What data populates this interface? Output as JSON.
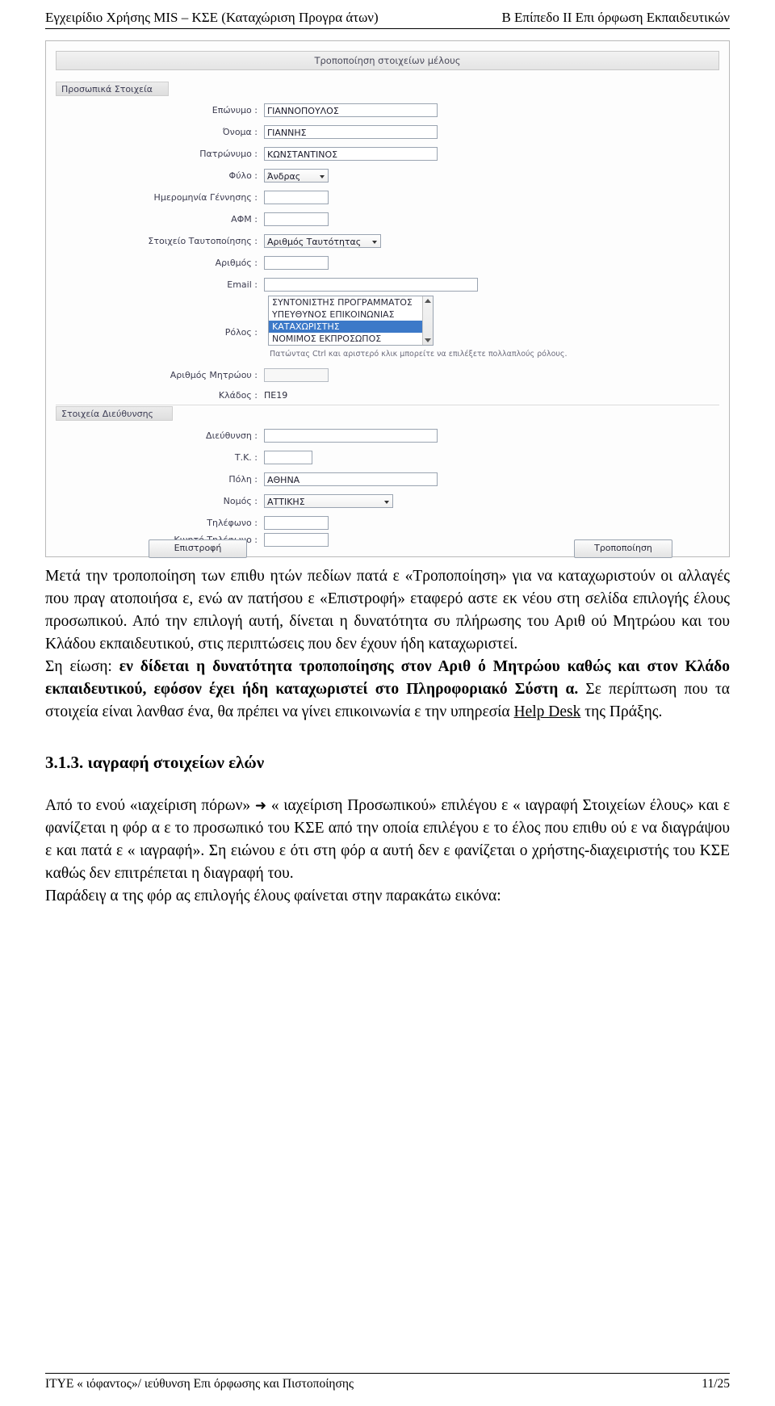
{
  "header": {
    "left": "Εγχειρίδιο Χρήσης MIS – ΚΣΕ (Καταχώριση Προγρα    άτων)",
    "right": "Β  Επίπεδο ΙΙ Επι  όρφωση Εκπαιδευτικών"
  },
  "figure": {
    "title": "Τροποποίηση στοιχείων μέλους",
    "section_personal": "Προσωπικά Στοιχεία",
    "section_address": "Στοιχεία Διεύθυνσης",
    "fields": [
      {
        "label": "Επώνυμο :",
        "value": "ΓΙΑΝΝΟΠΟΥΛΟΣ",
        "type": "text"
      },
      {
        "label": "Όνομα :",
        "value": "ΓΙΑΝΝΗΣ",
        "type": "text"
      },
      {
        "label": "Πατρώνυμο :",
        "value": "ΚΩΝΣΤΑΝΤΙΝΟΣ",
        "type": "text"
      },
      {
        "label": "Φύλο :",
        "value": "Άνδρας",
        "type": "select"
      },
      {
        "label": "Ημερομηνία Γέννησης :",
        "value": "",
        "type": "text"
      },
      {
        "label": "ΑΦΜ :",
        "value": "",
        "type": "text"
      },
      {
        "label": "Στοιχείο Ταυτοποίησης :",
        "value": "Αριθμός Ταυτότητας",
        "type": "select"
      },
      {
        "label": "Αριθμός :",
        "value": "",
        "type": "text"
      },
      {
        "label": "Email :",
        "value": "",
        "type": "text"
      },
      {
        "label": "Ρόλος :",
        "value": "",
        "type": "listbox"
      },
      {
        "label": "Αριθμός Μητρώου :",
        "value": "",
        "type": "text"
      },
      {
        "label": "Κλάδος :",
        "value": "ΠΕ19",
        "type": "text-plain"
      },
      {
        "label": "Διεύθυνση :",
        "value": "",
        "type": "text"
      },
      {
        "label": "Τ.Κ. :",
        "value": "",
        "type": "text"
      },
      {
        "label": "Πόλη :",
        "value": "ΑΘΗΝΑ",
        "type": "text"
      },
      {
        "label": "Νομός :",
        "value": "ΑΤΤΙΚΗΣ",
        "type": "select"
      },
      {
        "label": "Τηλέφωνο :",
        "value": "",
        "type": "text"
      },
      {
        "label": "Κινητό Τηλέφωνο :",
        "value": "",
        "type": "text"
      }
    ],
    "roles": [
      "ΣΥΝΤΟΝΙΣΤΗΣ ΠΡΟΓΡΑΜΜΑΤΟΣ",
      "ΥΠΕΥΘΥΝΟΣ ΕΠΙΚΟΙΝΩΝΙΑΣ",
      "ΚΑΤΑΧΩΡΙΣΤΗΣ",
      "ΝΟΜΙΜΟΣ ΕΚΠΡΟΣΩΠΟΣ"
    ],
    "roles_selected_index": 2,
    "roles_hint": "Πατώντας Ctrl και αριστερό κλικ μπορείτε να επιλέξετε πολλαπλούς ρόλους.",
    "buttons": {
      "back": "Επιστροφή",
      "modify": "Τροποποίηση"
    }
  },
  "text": {
    "p1_part1": "Μετά την τροποποίηση των επιθυ  ητών πεδίων πατά  ε «Τροποποίηση» για να καταχωριστούν οι αλλαγές που πραγ  ατοποιήσα  ε, ενώ αν πατήσου  ε «Επιστροφή» ",
    "p1_part2": "εταφερό  αστε εκ νέου στη σελίδα επιλογής   έλους προσωπικού. Από την επιλογή αυτή, δίνεται η δυνατότητα συ  πλήρωσης του Αριθ  ού Μητρώου και του Κλάδου εκπαιδευτικού, στις περιπτώσεις που δεν έχουν ήδη καταχωριστεί.",
    "p2_lead": "Ση  είωση:",
    "p2_bold": "εν δίδεται η δυνατότητα τροποποίησης στον Αριθ ό Μητρώου καθώς και στον Κλάδο εκπαιδευτικού, εφόσον έχει ήδη καταχωριστεί στο Πληροφοριακό Σύστη α.",
    "p2_rest_a": " Σε περίπτωση που τα στοιχεία είναι λανθασ  ένα, θα πρέπει να γίνει επικοινωνία   ε την υπηρεσία ",
    "p2_link": "Help Desk",
    "p2_rest_b": " της Πράξης.",
    "heading": "3.1.3.    ιαγραφή στοιχείων   ελών",
    "p3_a": "Από το   ενού «",
    "p3_menu1": "ιαχείριση  πόρων»",
    "p3_arrow": "",
    "p3_menu2": "«  ιαχείριση Προσωπικού»",
    "p3_b": " επιλέγου  ε «  ιαγραφή Στοιχείων   έλους» και ε  φανίζεται η φόρ  α   ε το προσωπικό του ΚΣΕ από την οποία επιλέγου  ε το   έλος που επιθυ  ού  ε να διαγράψου  ε και πατά  ε «  ιαγραφή».",
    "p3_c": " Ση  ειώνου  ε ότι στη φόρ  α αυτή δεν ε  φανίζεται ο χρήστης-διαχειριστής του ΚΣΕ καθώς δεν επιτρέπεται η διαγραφή του.",
    "p4": "Παράδειγ  α της φόρ  ας επιλογής   έλους φαίνεται στην παρακάτω εικόνα:"
  },
  "footer": {
    "left": "ΙΤΥΕ «  ιόφαντος»/   ιεύθυνση Επι  όρφωσης και Πιστοποίησης",
    "right": "11/25"
  }
}
